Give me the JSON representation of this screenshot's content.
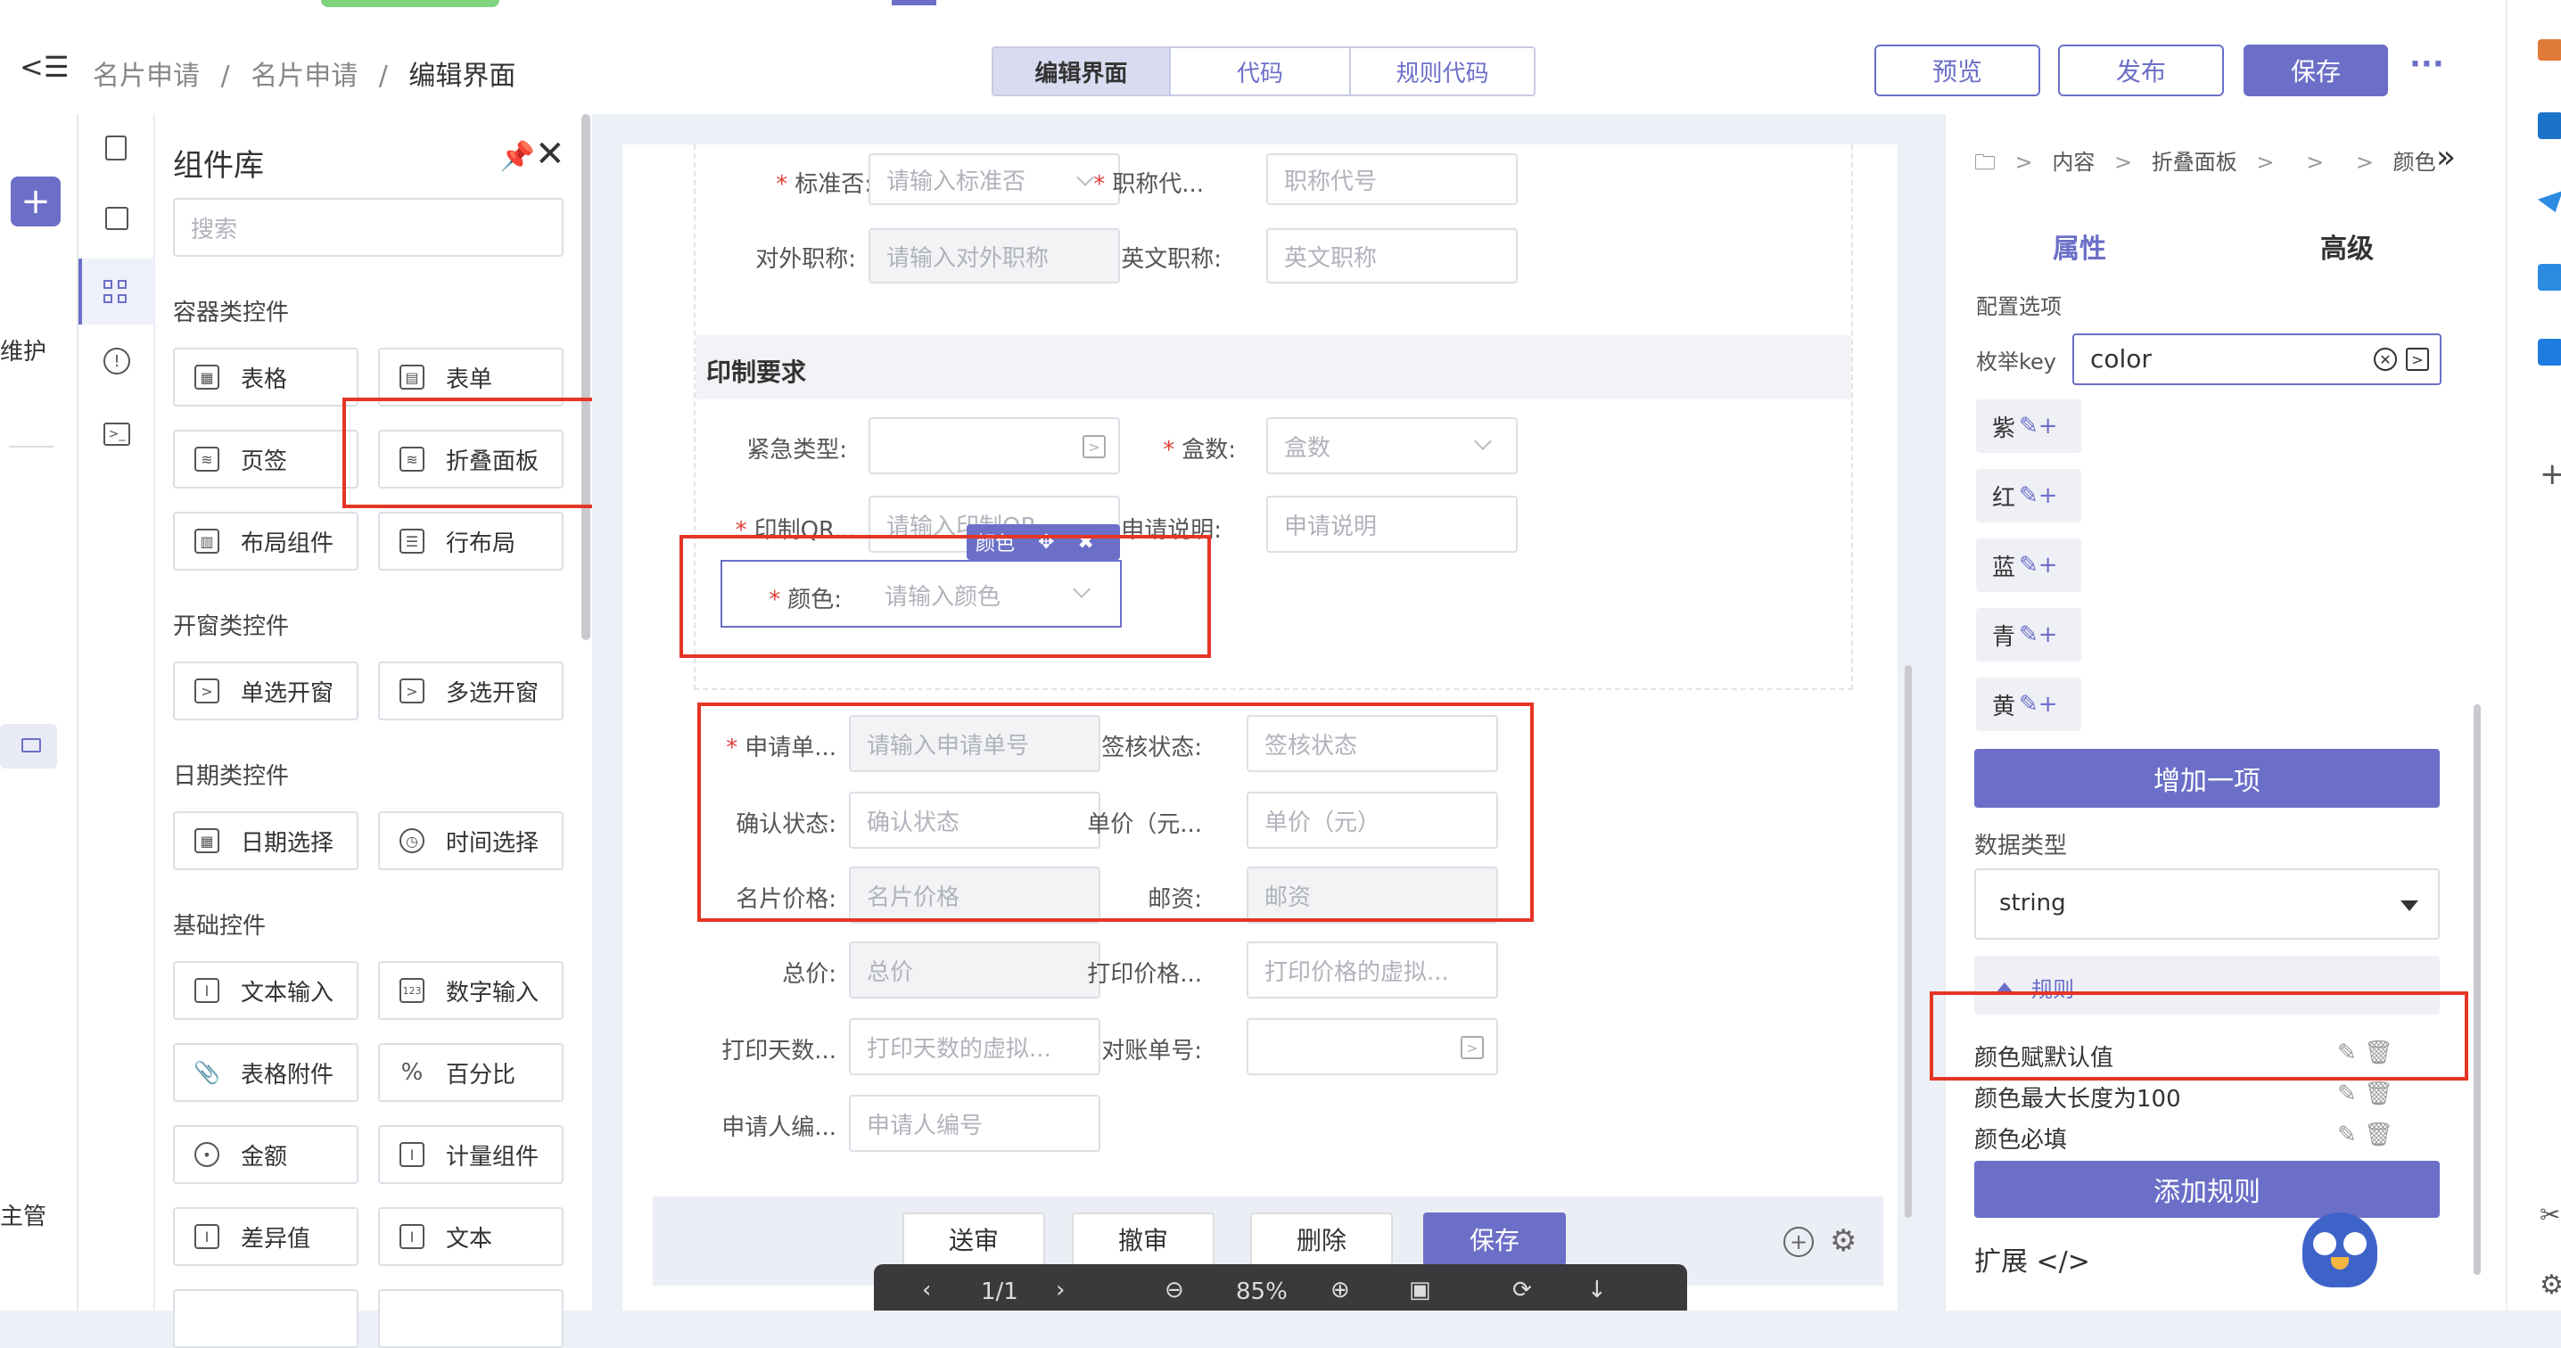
{
  "header": {
    "breadcrumb": [
      "名片申请",
      "/",
      "名片申请",
      "/",
      "编辑界面"
    ],
    "tabs": [
      "编辑界面",
      "代码",
      "规则代码"
    ],
    "buttons": {
      "preview": "预览",
      "publish": "发布",
      "save": "保存"
    },
    "more": "···"
  },
  "leftnav": {
    "collapse_icon": "<☰",
    "item1": "维护",
    "item2": "主管"
  },
  "library": {
    "title": "组件库",
    "search_placeholder": "搜索",
    "sections": {
      "container": "容器类控件",
      "dialog": "开窗类控件",
      "date": "日期类控件",
      "basic": "基础控件"
    },
    "items": {
      "table": "表格",
      "form": "表单",
      "tabs": "页签",
      "collapse": "折叠面板",
      "layout": "布局组件",
      "rowlayout": "行布局",
      "single_dialog": "单选开窗",
      "multi_dialog": "多选开窗",
      "date_select": "日期选择",
      "time_select": "时间选择",
      "text_input": "文本输入",
      "number_input": "数字输入",
      "table_attach": "表格附件",
      "percent": "百分比",
      "amount": "金额",
      "measure": "计量组件",
      "diff": "差异值",
      "text": "文本"
    }
  },
  "form": {
    "row0": {
      "label1": "标准否:",
      "ph1": "请输入标准否",
      "label2": "职称代...",
      "ph2": "职称代号"
    },
    "row1": {
      "label1": "对外职称:",
      "ph1": "请输入对外职称",
      "label2": "英文职称:",
      "ph2": "英文职称"
    },
    "print_section": "印制要求",
    "urgent": {
      "label": "紧急类型:"
    },
    "boxes": {
      "label": "盒数:",
      "ph": "盒数"
    },
    "qr": {
      "label": "印制QR...",
      "ph": "请输入印制QR..."
    },
    "apply_desc": {
      "label": "申请说明:",
      "ph": "申请说明"
    },
    "color": {
      "label": "颜色:",
      "ph": "请输入颜色",
      "tag": "颜色"
    },
    "g1": {
      "label": "申请单...",
      "ph": "请输入申请单号"
    },
    "g2": {
      "label": "签核状态:",
      "ph": "签核状态"
    },
    "g3": {
      "label": "确认状态:",
      "ph": "确认状态"
    },
    "g4": {
      "label": "单价（元...",
      "ph": "单价（元）"
    },
    "g5": {
      "label": "名片价格:",
      "ph": "名片价格"
    },
    "g6": {
      "label": "邮资:",
      "ph": "邮资"
    },
    "g7": {
      "label": "总价:",
      "ph": "总价"
    },
    "g8": {
      "label": "打印价格...",
      "ph": "打印价格的虚拟..."
    },
    "g9": {
      "label": "打印天数...",
      "ph": "打印天数的虚拟..."
    },
    "g10": {
      "label": "对账单号:"
    },
    "g11": {
      "label": "申请人编...",
      "ph": "申请人编号"
    }
  },
  "footer_buttons": [
    "送审",
    "撤审",
    "删除",
    "保存"
  ],
  "viewer": {
    "page": "1/1",
    "zoom": "85%"
  },
  "right": {
    "crumbs": [
      "内容",
      ">",
      "折叠面板",
      ">",
      ">",
      ">",
      "颜色"
    ],
    "tabs": [
      "属性",
      "高级"
    ],
    "config_label": "配置选项",
    "enum_key_label": "枚举key",
    "enum_key_value": "color",
    "enums": [
      "紫",
      "红",
      "蓝",
      "青",
      "黄"
    ],
    "add_item": "增加一项",
    "data_type_label": "数据类型",
    "data_type_value": "string",
    "rules_header": "规则",
    "rules": [
      "颜色赋默认值",
      "颜色最大长度为100",
      "颜色必填"
    ],
    "add_rule": "添加规则",
    "extend": "扩展 </>"
  },
  "colors": {
    "accent": "#6b6fc7",
    "red_box": "#e53525"
  }
}
